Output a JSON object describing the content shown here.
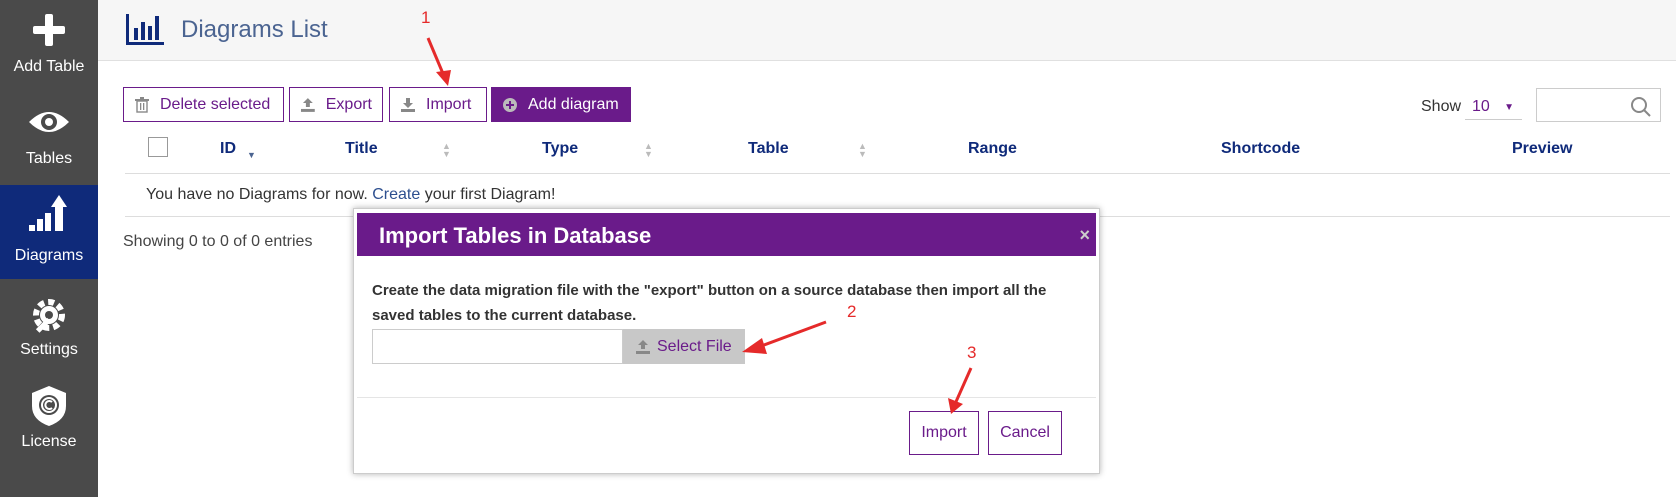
{
  "sidebar": {
    "items": [
      {
        "label": "Add Table",
        "icon": "plus-icon",
        "active": false
      },
      {
        "label": "Tables",
        "icon": "eye-icon",
        "active": false
      },
      {
        "label": "Diagrams",
        "icon": "bar-chart-arrow-icon",
        "active": true
      },
      {
        "label": "Settings",
        "icon": "gear-wrench-icon",
        "active": false
      },
      {
        "label": "License",
        "icon": "shield-copyright-icon",
        "active": false
      }
    ]
  },
  "header": {
    "title": "Diagrams List",
    "icon": "bar-chart-icon"
  },
  "toolbar": {
    "delete_label": "Delete selected",
    "export_label": "Export",
    "import_label": "Import",
    "add_label": "Add diagram",
    "show_label": "Show",
    "show_value": "10",
    "search_placeholder": ""
  },
  "table": {
    "columns": [
      "ID",
      "Title",
      "Type",
      "Table",
      "Range",
      "Shortcode",
      "Preview"
    ],
    "empty_text_before": "You have no Diagrams for now.",
    "empty_link": "Create",
    "empty_text_after": "your first Diagram!",
    "showing": "Showing 0 to 0 of 0 entries"
  },
  "modal": {
    "title": "Import Tables in Database",
    "close": "×",
    "description": "Create the data migration file with the \"export\" button on a source database then import all the saved tables to the current database.",
    "select_file_label": "Select File",
    "import_label": "Import",
    "cancel_label": "Cancel"
  },
  "annotations": [
    "1",
    "2",
    "3"
  ],
  "colors": {
    "accent": "#6a1b8a",
    "sidebar": "#4a4a4a",
    "sidebar_active": "#0f2a7a",
    "annotation": "#e52a2a"
  }
}
